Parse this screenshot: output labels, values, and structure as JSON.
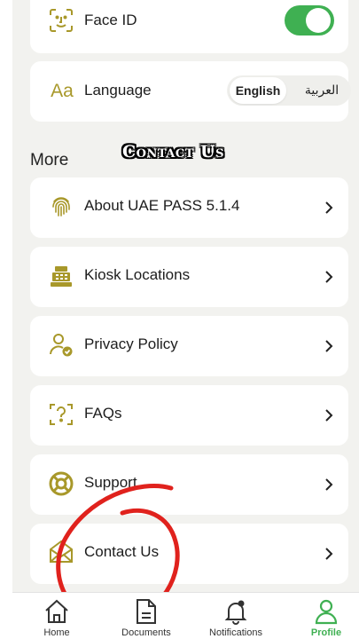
{
  "settings": {
    "face_id": {
      "label": "Face ID",
      "enabled": true,
      "icon": "face-id-icon"
    },
    "language": {
      "icon_text": "Aa",
      "label": "Language",
      "options": [
        "English",
        "العربية"
      ],
      "selected": "English"
    }
  },
  "more": {
    "title": "More",
    "items": [
      {
        "label": "About UAE PASS 5.1.4",
        "icon": "fingerprint-icon"
      },
      {
        "label": "Kiosk Locations",
        "icon": "kiosk-icon"
      },
      {
        "label": "Privacy Policy",
        "icon": "privacy-user-icon"
      },
      {
        "label": "FAQs",
        "icon": "faq-icon"
      },
      {
        "label": "Support",
        "icon": "lifebuoy-icon"
      },
      {
        "label": "Contact Us",
        "icon": "envelope-icon"
      }
    ]
  },
  "overlay_caption": "Contact Us",
  "bottom_nav": [
    {
      "label": "Home",
      "icon": "home-icon"
    },
    {
      "label": "Documents",
      "icon": "document-icon"
    },
    {
      "label": "Notifications",
      "icon": "bell-icon"
    },
    {
      "label": "Profile",
      "icon": "profile-icon",
      "active": true
    }
  ],
  "colors": {
    "accent_green": "#3fb052",
    "icon_gold": "#a8982a",
    "annotation_red": "#e0221d",
    "background": "#f2f2ef"
  }
}
